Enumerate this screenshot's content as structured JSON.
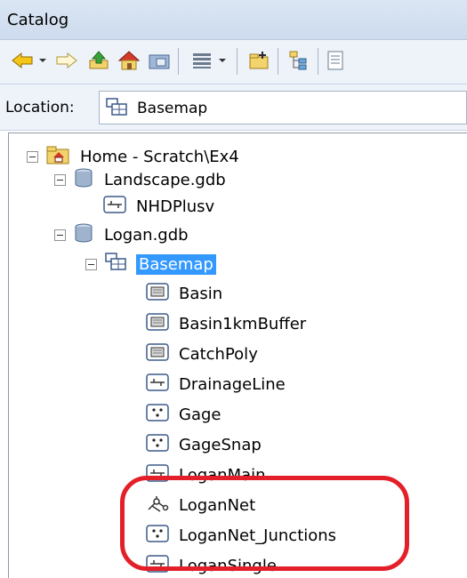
{
  "window": {
    "title": "Catalog"
  },
  "toolbar": {
    "buttons": [
      {
        "name": "back-icon"
      },
      {
        "name": "forward-icon"
      },
      {
        "name": "up-folder-icon"
      },
      {
        "name": "home-icon"
      },
      {
        "name": "connect-folder-icon"
      },
      {
        "name": "views-icon"
      },
      {
        "name": "new-folder-icon"
      },
      {
        "name": "tree-options-icon"
      },
      {
        "name": "list-icon"
      }
    ]
  },
  "location": {
    "label": "Location:",
    "value": "Basemap"
  },
  "tree": {
    "items": [
      {
        "label": "Home - Scratch\\Ex4",
        "icon": "home-folder-icon"
      },
      {
        "label": "Landscape.gdb",
        "icon": "geodatabase-icon"
      },
      {
        "label": "NHDPlusv",
        "icon": "line-feature-icon"
      },
      {
        "label": "Logan.gdb",
        "icon": "geodatabase-icon"
      },
      {
        "label": "Basemap",
        "icon": "feature-dataset-icon"
      },
      {
        "label": "Basin",
        "icon": "polygon-feature-icon"
      },
      {
        "label": "Basin1kmBuffer",
        "icon": "polygon-feature-icon"
      },
      {
        "label": "CatchPoly",
        "icon": "polygon-feature-icon"
      },
      {
        "label": "DrainageLine",
        "icon": "line-feature-icon"
      },
      {
        "label": "Gage",
        "icon": "point-feature-icon"
      },
      {
        "label": "GageSnap",
        "icon": "point-feature-icon"
      },
      {
        "label": "LoganMain",
        "icon": "line-feature-icon"
      },
      {
        "label": "LoganNet",
        "icon": "network-icon"
      },
      {
        "label": "LoganNet_Junctions",
        "icon": "point-feature-icon"
      },
      {
        "label": "LoganSingle",
        "icon": "line-feature-icon"
      }
    ]
  },
  "annotation": {
    "color": "#e3202a"
  }
}
